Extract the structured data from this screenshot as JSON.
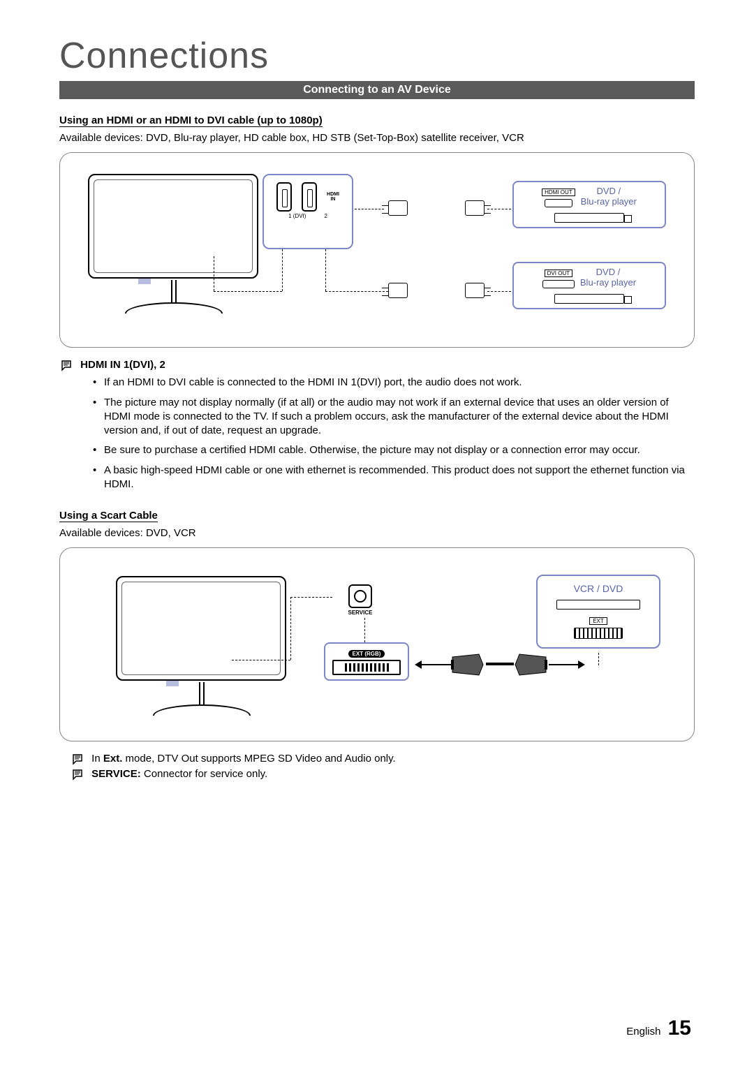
{
  "page": {
    "title": "Connections",
    "section_bar": "Connecting to an AV Device",
    "footer_lang": "English",
    "footer_page": "15"
  },
  "hdmi_section": {
    "heading": "Using an HDMI or an HDMI to DVI cable (up to 1080p)",
    "available": "Available devices: DVD, Blu-ray player, HD cable box, HD STB (Set-Top-Box) satellite receiver, VCR",
    "panel_label_top": "HDMI",
    "panel_label_bottom": "IN",
    "panel_num1": "1 (DVI)",
    "panel_num2": "2",
    "device1_port": "HDMI OUT",
    "device1_name_l1": "DVD /",
    "device1_name_l2": "Blu-ray player",
    "device2_port": "DVI OUT",
    "device2_name_l1": "DVD /",
    "device2_name_l2": "Blu-ray player",
    "note_heading": "HDMI IN 1(DVI), 2",
    "bullets": [
      "If an HDMI to DVI cable is connected to the HDMI IN 1(DVI) port, the audio does not work.",
      "The picture may not display normally (if at all) or the audio may not work if an external device that uses an older version of HDMI mode is connected to the TV. If such a problem occurs, ask the manufacturer of the external device about the HDMI version and, if out of date, request an upgrade.",
      "Be sure to purchase a certified HDMI cable. Otherwise, the picture may not display or a connection error may occur.",
      "A basic high-speed HDMI cable or one with ethernet is recommended. This product does not support the ethernet function via HDMI."
    ]
  },
  "scart_section": {
    "heading": "Using a Scart Cable",
    "available": "Available devices: DVD, VCR",
    "service_label": "SERVICE",
    "ext_label": "EXT (RGB)",
    "vcr_label": "VCR / DVD",
    "vcr_port_label": "EXT",
    "note1_pre": "In ",
    "note1_bold": "Ext.",
    "note1_post": " mode, DTV Out supports MPEG SD Video and Audio only.",
    "note2_bold": "SERVICE:",
    "note2_post": " Connector for service only."
  }
}
